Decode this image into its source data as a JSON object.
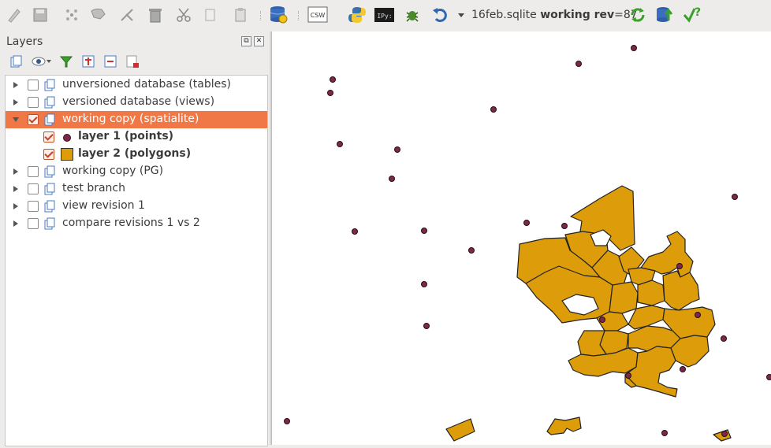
{
  "toolbar": {
    "db_name": "16feb.sqlite",
    "working_label": "working rev",
    "rev_value": "=87",
    "csw_label": "CSW",
    "ipython_label": "IPy:"
  },
  "layers_panel": {
    "title": "Layers",
    "float_btn": "⧉",
    "close_btn": "✕",
    "items": [
      {
        "label": "unversioned database (tables)",
        "checked": false,
        "expanded": false
      },
      {
        "label": "versioned database (views)",
        "checked": false,
        "expanded": false
      },
      {
        "label": "working copy (spatialite)",
        "checked": true,
        "expanded": true,
        "selected": true
      },
      {
        "label": "layer 1 (points)",
        "checked": true,
        "child": true
      },
      {
        "label": "layer 2 (polygons)",
        "checked": true,
        "child": true
      },
      {
        "label": "working copy (PG)",
        "checked": false,
        "expanded": false
      },
      {
        "label": "test branch",
        "checked": false,
        "expanded": false
      },
      {
        "label": "view revision 1",
        "checked": false,
        "expanded": false
      },
      {
        "label": "compare revisions 1 vs 2",
        "checked": false,
        "expanded": false
      }
    ]
  },
  "colors": {
    "selection": "#f07746",
    "polygon_fill": "#dd9c0a",
    "point_fill": "#7a2a48"
  }
}
